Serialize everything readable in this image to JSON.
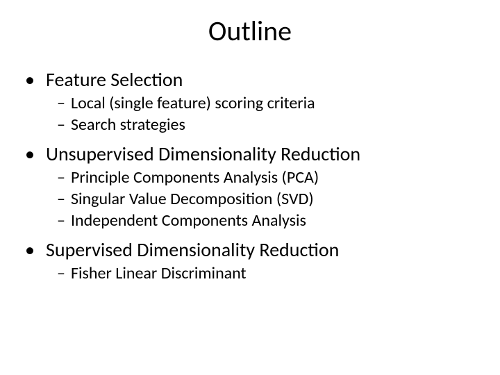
{
  "title": "Outline",
  "items": [
    {
      "label": "Feature Selection",
      "sub": [
        "Local (single feature) scoring criteria",
        "Search strategies"
      ]
    },
    {
      "label": "Unsupervised Dimensionality Reduction",
      "sub": [
        "Principle Components Analysis (PCA)",
        "Singular Value Decomposition (SVD)",
        "Independent Components Analysis"
      ]
    },
    {
      "label": "Supervised Dimensionality Reduction",
      "sub": [
        "Fisher Linear Discriminant"
      ]
    }
  ]
}
